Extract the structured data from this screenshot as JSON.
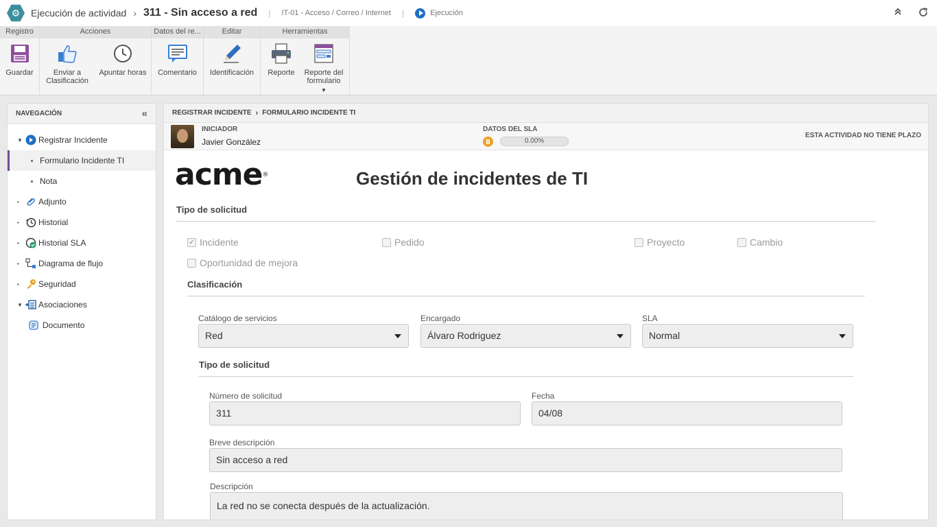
{
  "titlebar": {
    "crumb": "Ejecución de actividad",
    "title": "311 - Sin acceso a red",
    "process": "IT-01 - Acceso / Correo / Internet",
    "status": "Ejecución"
  },
  "ribbon": {
    "groups": [
      {
        "title": "Registro"
      },
      {
        "title": "Acciones"
      },
      {
        "title": "Datos del re..."
      },
      {
        "title": "Editar"
      },
      {
        "title": "Herramientas"
      }
    ],
    "buttons": {
      "save": "Guardar",
      "send": "Enviar a Clasificación",
      "hours": "Apuntar horas",
      "comment": "Comentario",
      "identification": "Identificación",
      "report": "Reporte",
      "form_report": "Reporte del formulario"
    }
  },
  "sidebar": {
    "title": "NAVEGACIÓN",
    "items": [
      {
        "label": "Registrar Incidente"
      },
      {
        "label": "Formulario Incidente TI"
      },
      {
        "label": "Nota"
      },
      {
        "label": "Adjunto"
      },
      {
        "label": "Historial"
      },
      {
        "label": "Historial SLA"
      },
      {
        "label": "Diagrama de flujo"
      },
      {
        "label": "Seguridad"
      },
      {
        "label": "Asociaciones"
      },
      {
        "label": "Documento"
      }
    ]
  },
  "main": {
    "breadcrumb": [
      "REGISTRAR INCIDENTE",
      "FORMULARIO INCIDENTE TI"
    ],
    "initiator_label": "INICIADOR",
    "initiator_name": "Javier González",
    "sla_label": "DATOS DEL SLA",
    "sla_progress_text": "0.00%",
    "sla_progress": 0,
    "no_deadline": "ESTA ACTIVIDAD NO TIENE PLAZO"
  },
  "form": {
    "logo": "acme",
    "title": "Gestión de incidentes de TI",
    "section_request_type": "Tipo de solicitud",
    "checkboxes": [
      {
        "label": "Incidente",
        "checked": true
      },
      {
        "label": "Pedido",
        "checked": false
      },
      {
        "label": "Proyecto",
        "checked": false
      },
      {
        "label": "Cambio",
        "checked": false
      },
      {
        "label": "Oportunidad de mejora",
        "checked": false
      }
    ],
    "section_classification": "Clasificación",
    "catalog_label": "Catálogo de servicios",
    "catalog_value": "Red",
    "assignee_label": "Encargado",
    "assignee_value": "Álvaro Rodriguez",
    "sla_field_label": "SLA",
    "sla_field_value": "Normal",
    "section_request_type_2": "Tipo de solicitud",
    "number_label": "Número de solicitud",
    "number_value": "311",
    "date_label": "Fecha",
    "date_value": "04/08",
    "brief_label": "Breve descripción",
    "brief_value": "Sin acceso a red",
    "desc_label": "Descripción",
    "desc_value": "La red no se conecta después de la actualización."
  }
}
